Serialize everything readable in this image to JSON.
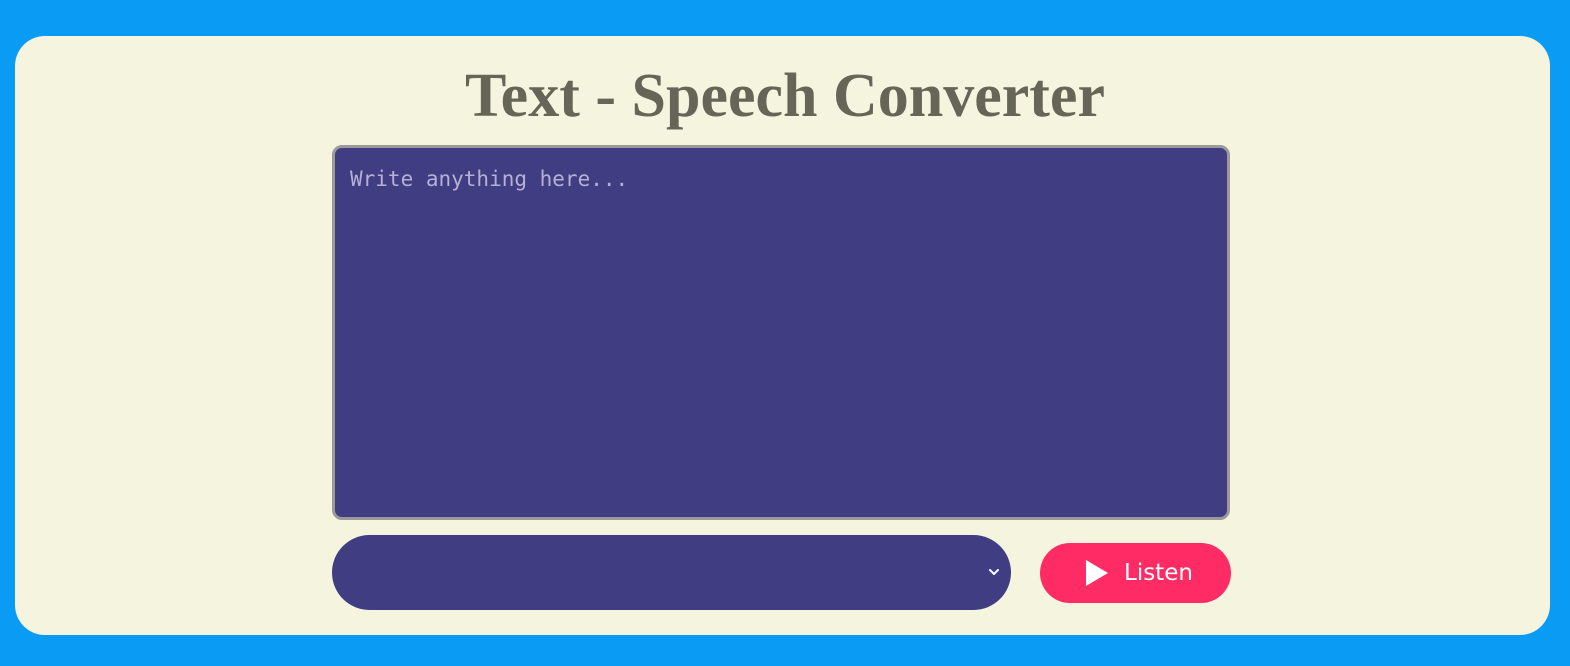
{
  "app": {
    "title": "Text - Speech Converter"
  },
  "input": {
    "value": "",
    "placeholder": "Write anything here..."
  },
  "voice_select": {
    "selected": "",
    "icon": "chevron-down-icon"
  },
  "listen_button": {
    "label": "Listen",
    "icon": "play-icon"
  },
  "colors": {
    "page_background": "#0a9cf5",
    "card_background": "#f5f5df",
    "title": "#666658",
    "input_background": "#403d82",
    "button_accent": "#ff2b64"
  }
}
